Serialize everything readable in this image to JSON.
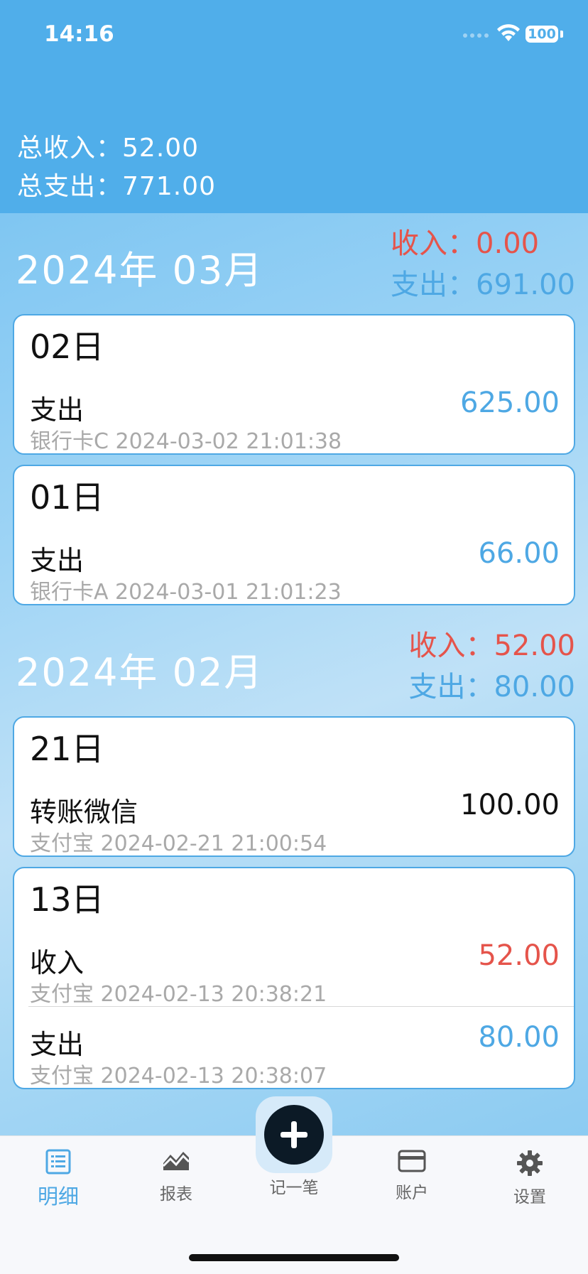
{
  "status_bar": {
    "time": "14:16",
    "battery": "100"
  },
  "summary": {
    "income_label": "总收入：",
    "income_value": "52.00",
    "expense_label": "总支出：",
    "expense_value": "771.00"
  },
  "months": [
    {
      "title": "2024年 03月",
      "income_label": "收入：",
      "income_value": "0.00",
      "expense_label": "支出：",
      "expense_value": "691.00",
      "days": [
        {
          "day": "02日",
          "entries": [
            {
              "type": "支出",
              "meta": "银行卡C 2024-03-02 21:01:38",
              "amount": "625.00",
              "kind": "expense"
            }
          ]
        },
        {
          "day": "01日",
          "entries": [
            {
              "type": "支出",
              "meta": "银行卡A 2024-03-01 21:01:23",
              "amount": "66.00",
              "kind": "expense"
            }
          ]
        }
      ]
    },
    {
      "title": "2024年 02月",
      "income_label": "收入：",
      "income_value": "52.00",
      "expense_label": "支出：",
      "expense_value": "80.00",
      "days": [
        {
          "day": "21日",
          "entries": [
            {
              "type": "转账微信",
              "meta": "支付宝 2024-02-21 21:00:54",
              "amount": "100.00",
              "kind": "transfer"
            }
          ]
        },
        {
          "day": "13日",
          "entries": [
            {
              "type": "收入",
              "meta": "支付宝 2024-02-13 20:38:21",
              "amount": "52.00",
              "kind": "income"
            },
            {
              "type": "支出",
              "meta": "支付宝 2024-02-13 20:38:07",
              "amount": "80.00",
              "kind": "expense"
            }
          ]
        }
      ]
    }
  ],
  "tabbar": {
    "tabs": [
      {
        "label": "明细",
        "icon": "list-icon",
        "active": true
      },
      {
        "label": "报表",
        "icon": "chart-icon",
        "active": false
      },
      {
        "label": "记一笔",
        "icon": "plus-icon",
        "active": false
      },
      {
        "label": "账户",
        "icon": "card-icon",
        "active": false
      },
      {
        "label": "设置",
        "icon": "gear-icon",
        "active": false
      }
    ]
  },
  "colors": {
    "header": "#50aeea",
    "income": "#e5544b",
    "expense": "#4ea8e4",
    "active_tab": "#4ea8e4"
  }
}
